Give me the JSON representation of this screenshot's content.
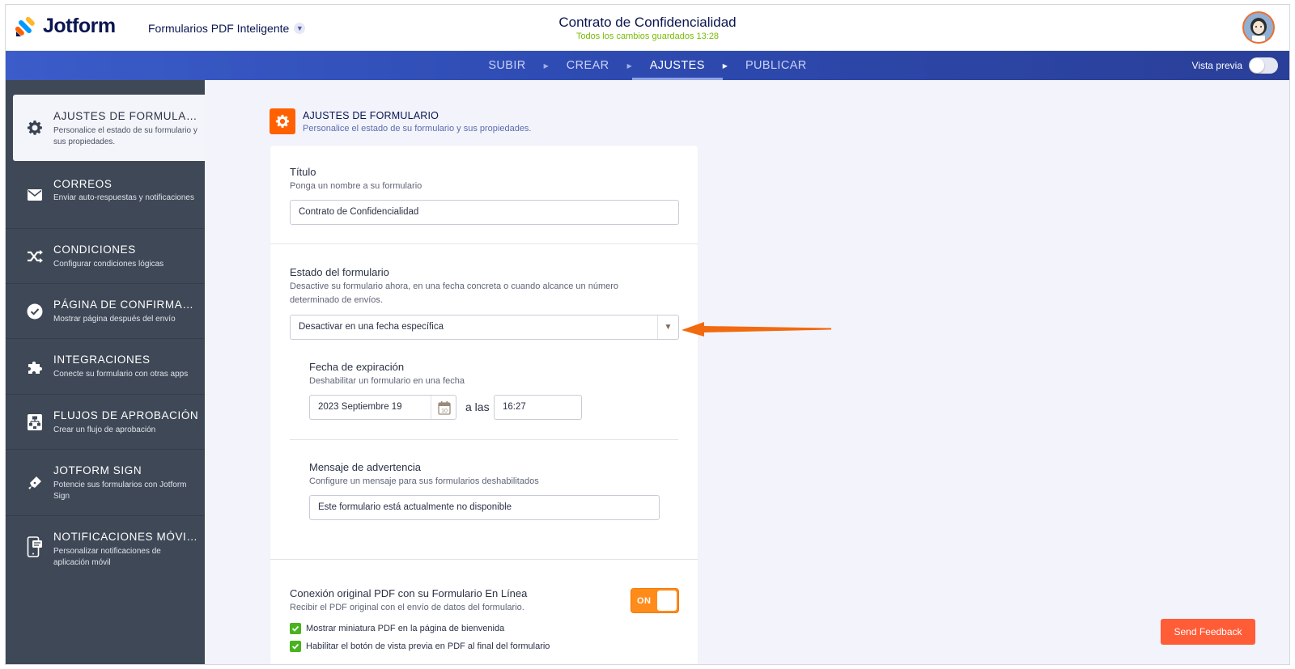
{
  "header": {
    "brand": "Jotform",
    "product": "Formularios PDF Inteligente",
    "form_title": "Contrato de Confidencialidad",
    "save_status": "Todos los cambios guardados 13:28"
  },
  "nav": {
    "steps": [
      {
        "label": "SUBIR",
        "active": false
      },
      {
        "label": "CREAR",
        "active": false
      },
      {
        "label": "AJUSTES",
        "active": true
      },
      {
        "label": "PUBLICAR",
        "active": false
      }
    ],
    "preview_label": "Vista previa"
  },
  "sidebar": {
    "items": [
      {
        "title": "AJUSTES DE FORMULARIO",
        "desc": "Personalice el estado de su formulario y sus propiedades.",
        "icon": "gear-icon"
      },
      {
        "title": "CORREOS",
        "desc": "Enviar auto-respuestas y notificaciones",
        "icon": "mail-icon"
      },
      {
        "title": "CONDICIONES",
        "desc": "Configurar condiciones lógicas",
        "icon": "shuffle-icon"
      },
      {
        "title": "PÁGINA DE CONFIRMACIÓN",
        "desc": "Mostrar página después del envío",
        "icon": "check-circle-icon"
      },
      {
        "title": "INTEGRACIONES",
        "desc": "Conecte su formulario con otras apps",
        "icon": "puzzle-icon"
      },
      {
        "title": "FLUJOS DE APROBACIÓN",
        "desc": "Crear un flujo de aprobación",
        "icon": "flow-icon"
      },
      {
        "title": "JOTFORM SIGN",
        "desc": "Potencie sus formularios con Jotform Sign",
        "icon": "pen-icon"
      },
      {
        "title": "NOTIFICACIONES MÓVILES",
        "desc": "Personalizar notificaciones de aplicación móvil",
        "icon": "mobile-icon"
      }
    ]
  },
  "section": {
    "title": "AJUSTES DE FORMULARIO",
    "desc": "Personalice el estado de su formulario y sus propiedades."
  },
  "form": {
    "title_label": "Título",
    "title_help": "Ponga un nombre a su formulario",
    "title_value": "Contrato de Confidencialidad",
    "status_label": "Estado del formulario",
    "status_help": "Desactive su formulario ahora, en una fecha concreta o cuando alcance un número determinado de envíos.",
    "status_value": "Desactivar en una fecha específica",
    "expiry_label": "Fecha de expiración",
    "expiry_help": "Deshabilitar un formulario en una fecha",
    "expiry_date": "2023 Septiembre 19",
    "calendar_day": "10",
    "at_label": "a las",
    "expiry_time": "16:27",
    "warning_label": "Mensaje de advertencia",
    "warning_help": "Configure un mensaje para sus formularios deshabilitados",
    "warning_value": "Este formulario está actualmente no disponible",
    "pdf_label": "Conexión original PDF con su Formulario En Línea",
    "pdf_help": "Recibir el PDF original con el envío de datos del formulario.",
    "pdf_toggle": "ON",
    "check1": "Mostrar miniatura PDF en la página de bienvenida",
    "check2": "Habilitar el botón de vista previa en PDF al final del formulario"
  },
  "feedback_label": "Send Feedback",
  "colors": {
    "brand_orange": "#ff6100",
    "nav_blue": "#2e4bb2",
    "sidebar_dark": "#3f4856",
    "saved_green": "#78bb07",
    "feedback": "#ff5c38"
  }
}
